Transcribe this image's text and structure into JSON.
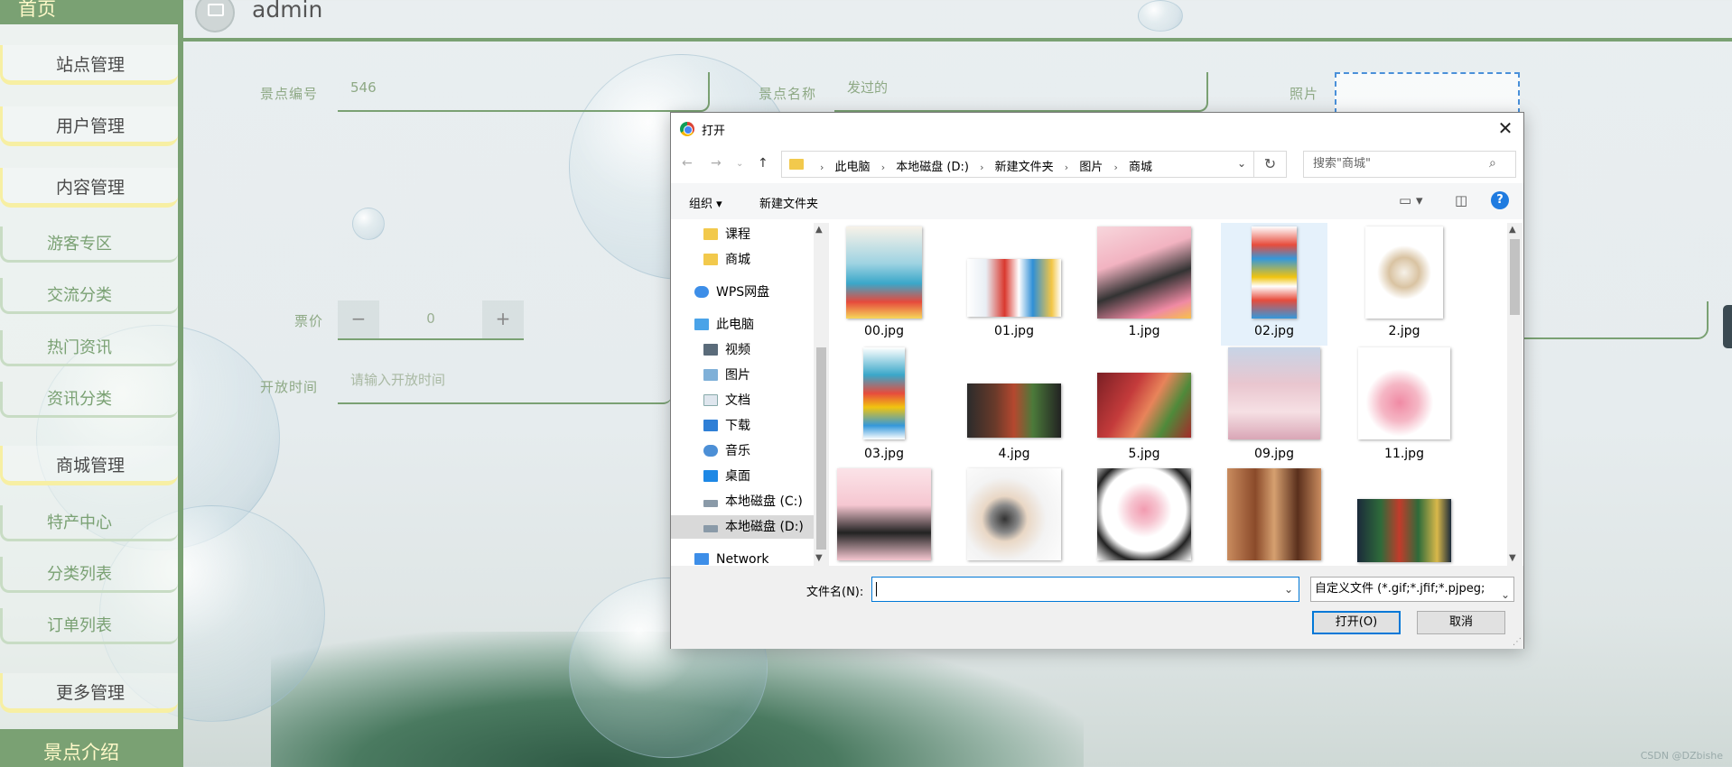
{
  "sidebar": {
    "header": "首页",
    "footer": "景点介绍",
    "groups": [
      {
        "label": "站点管理"
      },
      {
        "label": "用户管理"
      },
      {
        "label": "内容管理"
      },
      {
        "label": "商城管理"
      },
      {
        "label": "更多管理"
      }
    ],
    "subs": [
      {
        "label": "游客专区"
      },
      {
        "label": "交流分类"
      },
      {
        "label": "热门资讯"
      },
      {
        "label": "资讯分类"
      },
      {
        "label": "特产中心"
      },
      {
        "label": "分类列表"
      },
      {
        "label": "订单列表"
      }
    ]
  },
  "header": {
    "username": "admin"
  },
  "form": {
    "spot_no_label": "景点编号",
    "spot_no_value": "546",
    "spot_name_label": "景点名称",
    "spot_name_value": "发过的",
    "photo_label": "照片",
    "price_label": "票价",
    "price_value": "0",
    "price_minus": "−",
    "price_plus": "+",
    "open_time_label": "开放时间",
    "open_time_placeholder": "请输入开放时间"
  },
  "dialog": {
    "title": "打开",
    "close": "✕",
    "breadcrumbs": [
      "此电脑",
      "本地磁盘 (D:)",
      "新建文件夹",
      "图片",
      "商城"
    ],
    "search_placeholder": "搜索\"商城\"",
    "toolbar": {
      "organize": "组织 ▾",
      "new_folder": "新建文件夹"
    },
    "nav_tree": [
      {
        "label": "课程",
        "icon": "folder-icon"
      },
      {
        "label": "商城",
        "icon": "folder-icon"
      },
      {
        "label": "WPS网盘",
        "icon": "cloud-icon"
      },
      {
        "label": "此电脑",
        "icon": "pc-icon"
      },
      {
        "label": "视频",
        "icon": "video-icon"
      },
      {
        "label": "图片",
        "icon": "pictures-icon"
      },
      {
        "label": "文档",
        "icon": "documents-icon"
      },
      {
        "label": "下载",
        "icon": "download-icon"
      },
      {
        "label": "音乐",
        "icon": "music-icon"
      },
      {
        "label": "桌面",
        "icon": "desktop-icon"
      },
      {
        "label": "本地磁盘 (C:)",
        "icon": "drive-icon"
      },
      {
        "label": "本地磁盘 (D:)",
        "icon": "drive-icon"
      },
      {
        "label": "Network",
        "icon": "network-icon"
      }
    ],
    "files": [
      {
        "name": "00.jpg"
      },
      {
        "name": "01.jpg"
      },
      {
        "name": "1.jpg"
      },
      {
        "name": "02.jpg"
      },
      {
        "name": "2.jpg"
      },
      {
        "name": "03.jpg"
      },
      {
        "name": "4.jpg"
      },
      {
        "name": "5.jpg"
      },
      {
        "name": "09.jpg"
      },
      {
        "name": "11.jpg"
      },
      {
        "name": ""
      },
      {
        "name": ""
      },
      {
        "name": ""
      },
      {
        "name": ""
      },
      {
        "name": ""
      }
    ],
    "filename_label": "文件名(N):",
    "filename_value": "",
    "filetype_value": "自定义文件 (*.gif;*.jfif;*.pjpeg;",
    "open_button": "打开(O)",
    "cancel_button": "取消"
  },
  "watermark": "CSDN @DZbishe",
  "colors": {
    "accent": "#7aa173",
    "highlight": "#f7efa3",
    "dialog_accent": "#0078d7"
  }
}
